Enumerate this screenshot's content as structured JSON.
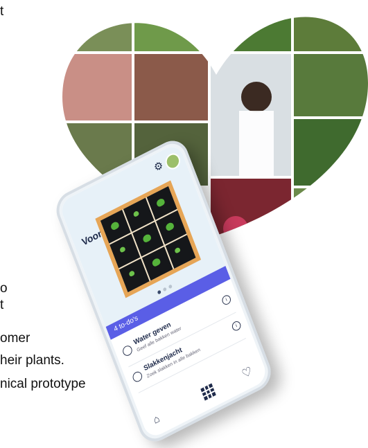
{
  "paragraph_fragments": [
    "t",
    "o",
    "t",
    "omer",
    "heir plants.",
    "nical prototype"
  ],
  "app": {
    "title": "Voortuin bak",
    "todo_header": "4 to-do's",
    "todos": [
      {
        "title": "Water geven",
        "subtitle": "Geef alle bakken water",
        "info": "i"
      },
      {
        "title": "Slakkenjacht",
        "subtitle": "Zoek slakken in alle bakken",
        "info": "i"
      }
    ],
    "settings_icon": "gear-icon",
    "nav_icons": [
      "home-icon",
      "grid-icon",
      "heart-icon"
    ]
  },
  "colors": {
    "accent": "#5a5ee6",
    "bed_frame": "#e6a556",
    "soil": "#15171a",
    "plant": "#55b33b"
  }
}
